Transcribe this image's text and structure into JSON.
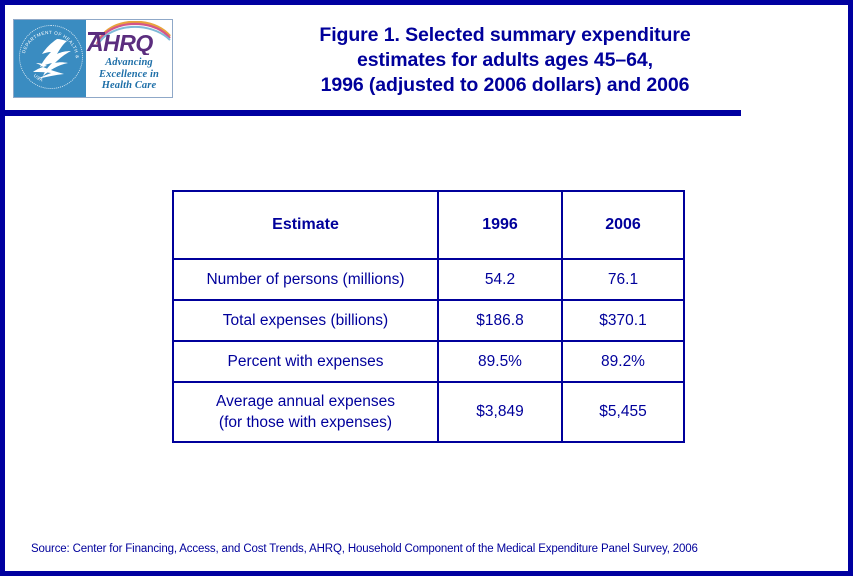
{
  "colors": {
    "border_blue": "#0000A0",
    "text_blue": "#00009B",
    "seal_blue": "#3A8CC1",
    "ahrq_purple": "#5B2D7E",
    "tagline_blue": "#1E6FA8"
  },
  "logo": {
    "seal_name": "hhs-seal",
    "seal_ring_text": "DEPARTMENT OF HEALTH & HUMAN SERVICES USA",
    "wordmark": "AHRQ",
    "tagline_lines": [
      "Advancing",
      "Excellence in",
      "Health Care"
    ]
  },
  "title": {
    "lines": [
      "Figure 1. Selected summary expenditure",
      "estimates for adults ages 45–64,",
      "1996 (adjusted to 2006 dollars) and 2006"
    ]
  },
  "chart_data": {
    "type": "table",
    "title": "Figure 1. Selected summary expenditure estimates for adults ages 45–64, 1996 (adjusted to 2006 dollars) and 2006",
    "columns": [
      "Estimate",
      "1996",
      "2006"
    ],
    "rows": [
      {
        "label": "Number of persons (millions)",
        "label_line2": "",
        "y1996": "54.2",
        "y2006": "76.1"
      },
      {
        "label": "Total expenses (billions)",
        "label_line2": "",
        "y1996": "$186.8",
        "y2006": "$370.1"
      },
      {
        "label": "Percent with expenses",
        "label_line2": "",
        "y1996": "89.5%",
        "y2006": "89.2%"
      },
      {
        "label": "Average annual expenses",
        "label_line2": "(for those with expenses)",
        "y1996": "$3,849",
        "y2006": "$5,455"
      }
    ]
  },
  "source": {
    "text": "Source: Center for Financing, Access, and Cost Trends, AHRQ, Household Component of the Medical Expenditure Panel Survey, 2006"
  }
}
